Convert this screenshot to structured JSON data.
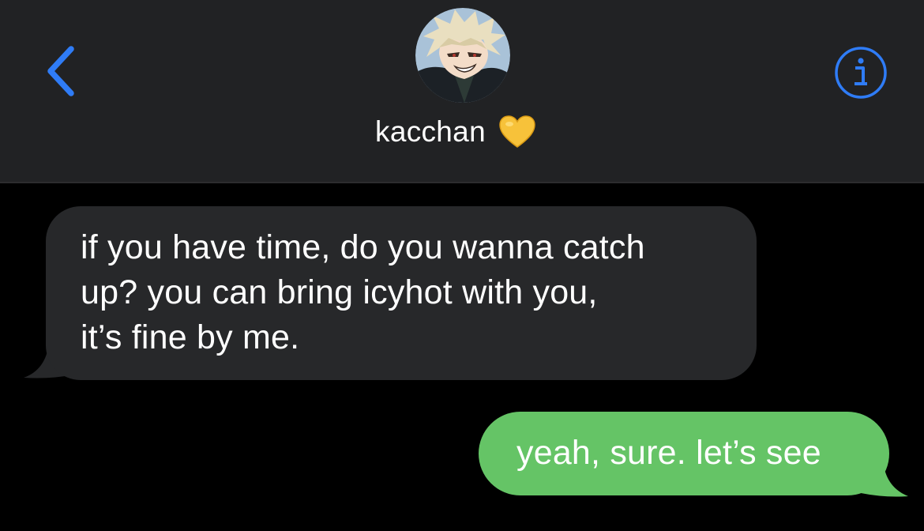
{
  "header": {
    "contact_name": "kacchan",
    "back_icon": "chevron-left-icon",
    "info_icon": "info-circle-icon",
    "heart_icon": "yellow-heart-icon",
    "avatar_icon": "contact-avatar"
  },
  "messages": [
    {
      "direction": "incoming",
      "lines": [
        "if you have time, do you wanna catch",
        "up? you can bring icyhot with you,",
        "it’s fine by me."
      ]
    },
    {
      "direction": "outgoing",
      "text": "yeah, sure. let’s see"
    }
  ],
  "colors": {
    "accent": "#2f7cf6",
    "header_bg": "#212224",
    "background": "#000000",
    "incoming_bubble": "#27282a",
    "outgoing_bubble": "#65c466",
    "heart": "#f7c23a"
  }
}
